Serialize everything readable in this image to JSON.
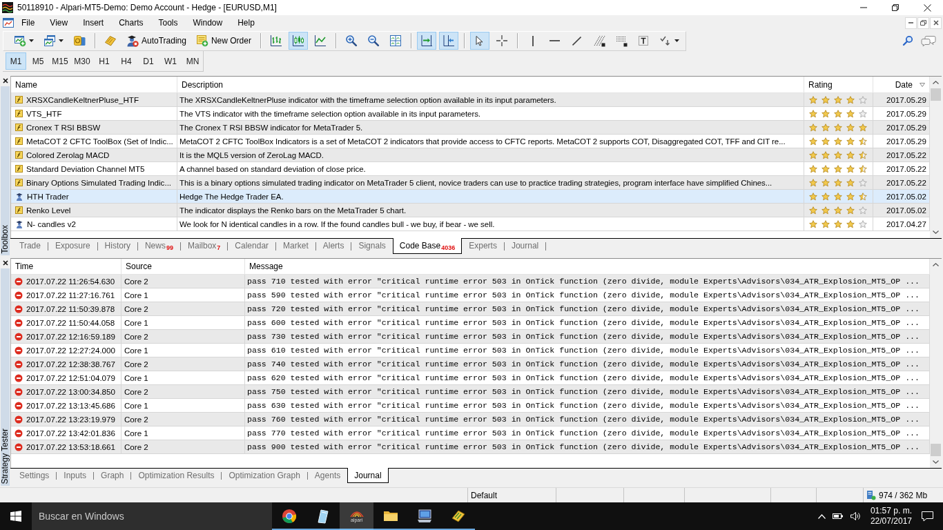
{
  "window": {
    "title": "50118910 - Alpari-MT5-Demo: Demo Account - Hedge - [EURUSD,M1]"
  },
  "menu": [
    "File",
    "View",
    "Insert",
    "Charts",
    "Tools",
    "Window",
    "Help"
  ],
  "toolbar": {
    "groups": [
      {
        "buttons": [
          {
            "kind": "newchart",
            "pressed": false,
            "dropdown": true
          },
          {
            "kind": "profiles",
            "pressed": false,
            "dropdown": true
          },
          {
            "kind": "market",
            "pressed": false,
            "dropdown": false
          }
        ]
      },
      {
        "buttons": [
          {
            "kind": "editor",
            "pressed": false,
            "dropdown": false
          },
          {
            "kind": "autotrading",
            "label": "AutoTrading",
            "pressed": false,
            "dropdown": false
          },
          {
            "kind": "neworder",
            "label": "New Order",
            "pressed": false,
            "dropdown": false
          }
        ]
      },
      {
        "buttons": [
          {
            "kind": "bars",
            "pressed": false,
            "dropdown": false
          },
          {
            "kind": "candles",
            "pressed": true,
            "dropdown": false
          },
          {
            "kind": "line",
            "pressed": false,
            "dropdown": false
          }
        ]
      },
      {
        "buttons": [
          {
            "kind": "zoomin",
            "pressed": false,
            "dropdown": false
          },
          {
            "kind": "zoomout",
            "pressed": false,
            "dropdown": false
          },
          {
            "kind": "tile",
            "pressed": false,
            "dropdown": false
          }
        ]
      },
      {
        "buttons": [
          {
            "kind": "autoscroll",
            "pressed": true,
            "dropdown": false
          },
          {
            "kind": "shift",
            "pressed": true,
            "dropdown": false
          }
        ]
      },
      {
        "buttons": [
          {
            "kind": "cursor",
            "pressed": true,
            "dropdown": false
          },
          {
            "kind": "crosshair",
            "pressed": false,
            "dropdown": false
          }
        ]
      },
      {
        "buttons": [
          {
            "kind": "vline",
            "pressed": false,
            "dropdown": false
          },
          {
            "kind": "hline",
            "pressed": false,
            "dropdown": false
          },
          {
            "kind": "trendline",
            "pressed": false,
            "dropdown": false
          },
          {
            "kind": "fibo",
            "pressed": false,
            "dropdown": false
          },
          {
            "kind": "fibogrid",
            "pressed": false,
            "dropdown": false
          },
          {
            "kind": "text",
            "pressed": false,
            "dropdown": false
          },
          {
            "kind": "arrows",
            "pressed": false,
            "dropdown": true
          }
        ]
      }
    ]
  },
  "timeframes": [
    {
      "label": "M1",
      "selected": true
    },
    {
      "label": "M5",
      "selected": false
    },
    {
      "label": "M15",
      "selected": false
    },
    {
      "label": "M30",
      "selected": false
    },
    {
      "label": "H1",
      "selected": false
    },
    {
      "label": "H4",
      "selected": false
    },
    {
      "label": "D1",
      "selected": false
    },
    {
      "label": "W1",
      "selected": false
    },
    {
      "label": "MN",
      "selected": false
    }
  ],
  "toolbox": {
    "label": "Toolbox",
    "columns": [
      {
        "label": "Name",
        "sorted": false
      },
      {
        "label": "Description",
        "sorted": false
      },
      {
        "label": "Rating",
        "sorted": false
      },
      {
        "label": "Date",
        "sorted": true
      }
    ],
    "rows": [
      {
        "kind": "indicator",
        "name": "XRSXCandleKeltnerPluse_HTF",
        "description": "The XRSXCandleKeltnerPluse indicator with the timeframe selection option available in its input parameters.",
        "stars": 4,
        "date": "2017.05.29",
        "selected": false
      },
      {
        "kind": "indicator",
        "name": "VTS_HTF",
        "description": "The VTS indicator with the timeframe selection option available in its input parameters.",
        "stars": 4,
        "date": "2017.05.29",
        "selected": false
      },
      {
        "kind": "indicator",
        "name": "Cronex T RSI BBSW",
        "description": "The Cronex T RSI BBSW indicator for MetaTrader 5.",
        "stars": 5,
        "date": "2017.05.29",
        "selected": false
      },
      {
        "kind": "indicator",
        "name": "MetaCOT 2 CFTC ToolBox (Set of Indic...",
        "description": "MetaCOT 2 CFTC ToolBox Indicators is a set of MetaCOT 2 indicators that provide access to CFTC reports. MetaCOT 2 supports COT, Disaggregated COT, TFF and CIT re...",
        "stars": 4.5,
        "date": "2017.05.29",
        "selected": false
      },
      {
        "kind": "indicator",
        "name": "Colored Zerolag MACD",
        "description": "It is the MQL5 version of ZeroLag MACD.",
        "stars": 4.5,
        "date": "2017.05.22",
        "selected": false
      },
      {
        "kind": "indicator",
        "name": "Standard Deviation Channel MT5",
        "description": "A channel based on standard deviation of close price.",
        "stars": 4.5,
        "date": "2017.05.22",
        "selected": false
      },
      {
        "kind": "indicator",
        "name": "Binary Options Simulated Trading Indic...",
        "description": "This is a binary options simulated trading indicator on MetaTrader 5 client, novice traders can use to practice trading strategies, program interface have simplified Chines...",
        "stars": 4,
        "date": "2017.05.22",
        "selected": false
      },
      {
        "kind": "expert",
        "name": "HTH Trader",
        "description": "Hedge The Hedge Trader EA.",
        "stars": 4.5,
        "date": "2017.05.02",
        "selected": true
      },
      {
        "kind": "indicator",
        "name": "Renko Level",
        "description": "The indicator displays the Renko bars on the MetaTrader 5 chart.",
        "stars": 4,
        "date": "2017.05.02",
        "selected": false
      },
      {
        "kind": "expert",
        "name": "N- candles v2",
        "description": "We look for N identical candles in a row. If the found candles bull - we buy, if bear - we sell.",
        "stars": 4,
        "date": "2017.04.27",
        "selected": false
      }
    ],
    "tabs": [
      {
        "label": "Trade",
        "selected": false
      },
      {
        "label": "Exposure",
        "selected": false
      },
      {
        "label": "History",
        "selected": false
      },
      {
        "label": "News",
        "count": "99",
        "selected": false
      },
      {
        "label": "Mailbox",
        "count": "7",
        "selected": false
      },
      {
        "label": "Calendar",
        "selected": false
      },
      {
        "label": "Market",
        "selected": false
      },
      {
        "label": "Alerts",
        "selected": false
      },
      {
        "label": "Signals",
        "selected": false
      },
      {
        "label": "Code Base",
        "count": "4036",
        "selected": true
      },
      {
        "label": "Experts",
        "selected": false
      },
      {
        "label": "Journal",
        "selected": false
      }
    ]
  },
  "strategy_tester": {
    "label": "Strategy Tester",
    "columns": [
      "Time",
      "Source",
      "Message"
    ],
    "rows": [
      {
        "kind": "error",
        "time": "2017.07.22 11:26:54.630",
        "source": "Core 2",
        "message": "pass 710 tested with error \"critical runtime error 503 in OnTick function (zero divide, module Experts\\Advisors\\034_ATR_Explosion_MT5_OP ..."
      },
      {
        "kind": "error",
        "time": "2017.07.22 11:27:16.761",
        "source": "Core 1",
        "message": "pass 590 tested with error \"critical runtime error 503 in OnTick function (zero divide, module Experts\\Advisors\\034_ATR_Explosion_MT5_OP ..."
      },
      {
        "kind": "error",
        "time": "2017.07.22 11:50:39.878",
        "source": "Core 2",
        "message": "pass 720 tested with error \"critical runtime error 503 in OnTick function (zero divide, module Experts\\Advisors\\034_ATR_Explosion_MT5_OP ..."
      },
      {
        "kind": "error",
        "time": "2017.07.22 11:50:44.058",
        "source": "Core 1",
        "message": "pass 600 tested with error \"critical runtime error 503 in OnTick function (zero divide, module Experts\\Advisors\\034_ATR_Explosion_MT5_OP ..."
      },
      {
        "kind": "error",
        "time": "2017.07.22 12:16:59.189",
        "source": "Core 2",
        "message": "pass 730 tested with error \"critical runtime error 503 in OnTick function (zero divide, module Experts\\Advisors\\034_ATR_Explosion_MT5_OP ..."
      },
      {
        "kind": "error",
        "time": "2017.07.22 12:27:24.000",
        "source": "Core 1",
        "message": "pass 610 tested with error \"critical runtime error 503 in OnTick function (zero divide, module Experts\\Advisors\\034_ATR_Explosion_MT5_OP ..."
      },
      {
        "kind": "error",
        "time": "2017.07.22 12:38:38.767",
        "source": "Core 2",
        "message": "pass 740 tested with error \"critical runtime error 503 in OnTick function (zero divide, module Experts\\Advisors\\034_ATR_Explosion_MT5_OP ..."
      },
      {
        "kind": "error",
        "time": "2017.07.22 12:51:04.079",
        "source": "Core 1",
        "message": "pass 620 tested with error \"critical runtime error 503 in OnTick function (zero divide, module Experts\\Advisors\\034_ATR_Explosion_MT5_OP ..."
      },
      {
        "kind": "error",
        "time": "2017.07.22 13:00:34.850",
        "source": "Core 2",
        "message": "pass 750 tested with error \"critical runtime error 503 in OnTick function (zero divide, module Experts\\Advisors\\034_ATR_Explosion_MT5_OP ..."
      },
      {
        "kind": "error",
        "time": "2017.07.22 13:13:45.686",
        "source": "Core 1",
        "message": "pass 630 tested with error \"critical runtime error 503 in OnTick function (zero divide, module Experts\\Advisors\\034_ATR_Explosion_MT5_OP ..."
      },
      {
        "kind": "error",
        "time": "2017.07.22 13:23:19.979",
        "source": "Core 2",
        "message": "pass 760 tested with error \"critical runtime error 503 in OnTick function (zero divide, module Experts\\Advisors\\034_ATR_Explosion_MT5_OP ..."
      },
      {
        "kind": "error",
        "time": "2017.07.22 13:42:01.836",
        "source": "Core 1",
        "message": "pass 770 tested with error \"critical runtime error 503 in OnTick function (zero divide, module Experts\\Advisors\\034_ATR_Explosion_MT5_OP ..."
      },
      {
        "kind": "error",
        "time": "2017.07.22 13:53:18.661",
        "source": "Core 2",
        "message": "pass 900 tested with error \"critical runtime error 503 in OnTick function (zero divide, module Experts\\Advisors\\034_ATR_Explosion_MT5_OP ..."
      }
    ],
    "tabs": [
      {
        "label": "Settings",
        "selected": false
      },
      {
        "label": "Inputs",
        "selected": false
      },
      {
        "label": "Graph",
        "selected": false
      },
      {
        "label": "Optimization Results",
        "selected": false
      },
      {
        "label": "Optimization Graph",
        "selected": false
      },
      {
        "label": "Agents",
        "selected": false
      },
      {
        "label": "Journal",
        "selected": true
      }
    ]
  },
  "status_bar": {
    "profile": "Default",
    "memory": "974 / 362 Mb"
  },
  "taskbar": {
    "search": {
      "placeholder": "Buscar en Windows"
    },
    "apps": [
      {
        "kind": "browser",
        "running": true,
        "selected": false
      },
      {
        "kind": "glass",
        "running": true,
        "selected": false
      },
      {
        "kind": "alpari",
        "label": "alpari",
        "running": true,
        "selected": true
      },
      {
        "kind": "folder",
        "running": true,
        "selected": false
      },
      {
        "kind": "monitor",
        "running": true,
        "selected": false
      },
      {
        "kind": "book",
        "running": true,
        "selected": false
      }
    ],
    "clock": {
      "time": "01:57 p. m.",
      "date": "22/07/2017"
    }
  }
}
